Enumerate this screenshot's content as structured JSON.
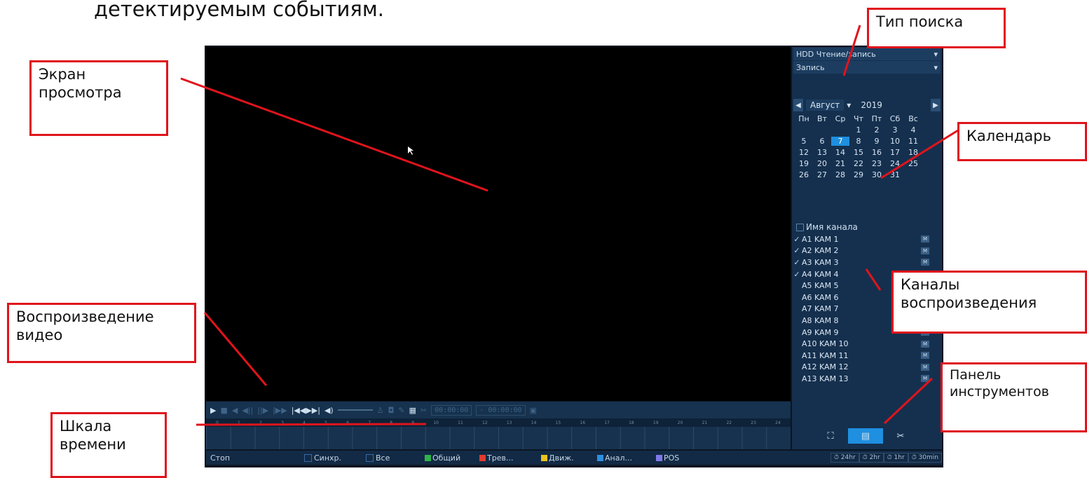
{
  "heading": "детектируемым событиям.",
  "caption_bottom": "",
  "player": {
    "search_type": "HDD Чтение/запись",
    "record_type": "Запись",
    "calendar": {
      "month": "Август",
      "year": "2019",
      "weekdays": [
        "Пн",
        "Вт",
        "Ср",
        "Чт",
        "Пт",
        "Сб",
        "Вс"
      ],
      "days": [
        "",
        "",
        "",
        "1",
        "2",
        "3",
        "4",
        "5",
        "6",
        "7",
        "8",
        "9",
        "10",
        "11",
        "12",
        "13",
        "14",
        "15",
        "16",
        "17",
        "18",
        "19",
        "20",
        "21",
        "22",
        "23",
        "24",
        "25",
        "26",
        "27",
        "28",
        "29",
        "30",
        "31"
      ],
      "selected_day": "7"
    },
    "channels_header": "Имя канала",
    "channels": [
      {
        "name": "A1 KAM 1",
        "checked": "✓"
      },
      {
        "name": "A2 KAM 2",
        "checked": "✓"
      },
      {
        "name": "A3 KAM 3",
        "checked": "✓"
      },
      {
        "name": "A4 KAM 4",
        "checked": "✓"
      },
      {
        "name": "A5 KAM 5",
        "checked": ""
      },
      {
        "name": "A6 KAM 6",
        "checked": ""
      },
      {
        "name": "A7 KAM 7",
        "checked": ""
      },
      {
        "name": "A8 KAM 8",
        "checked": ""
      },
      {
        "name": "A9 KAM 9",
        "checked": ""
      },
      {
        "name": "A10 KAM 10",
        "checked": ""
      },
      {
        "name": "A11 KAM 11",
        "checked": ""
      },
      {
        "name": "A12 KAM 12",
        "checked": ""
      },
      {
        "name": "A13 KAM 13",
        "checked": ""
      }
    ],
    "controls": {
      "time_start": "00:00:00",
      "time_end": "- 00:00:00"
    },
    "scale_hours": [
      "0",
      "1",
      "2",
      "3",
      "4",
      "5",
      "6",
      "7",
      "8",
      "9",
      "10",
      "11",
      "12",
      "13",
      "14",
      "15",
      "16",
      "17",
      "18",
      "19",
      "20",
      "21",
      "22",
      "23",
      "24"
    ],
    "status": {
      "stop": "Стоп",
      "sync": "Синхр.",
      "all": "Все",
      "legend": [
        {
          "label": "Общий",
          "color": "#2fb24c"
        },
        {
          "label": "Трев...",
          "color": "#e23b2e"
        },
        {
          "label": "Движ.",
          "color": "#e8c320"
        },
        {
          "label": "Анал...",
          "color": "#2f8fe0"
        },
        {
          "label": "POS",
          "color": "#7f79e8"
        }
      ],
      "periods": [
        "⏱ 24hr",
        "⏱ 2hr",
        "⏱ 1hr",
        "⏱ 30min"
      ]
    }
  },
  "callouts": {
    "screen": "Экран\nпросмотра",
    "search_type": "Тип поиска",
    "calendar": "Календарь",
    "channels": "Каналы\nвоспроизведения",
    "playback": "Воспроизведение\nвидео",
    "timeline": "Шкала\nвремени",
    "toolbar": "Панель\nинструментов"
  }
}
